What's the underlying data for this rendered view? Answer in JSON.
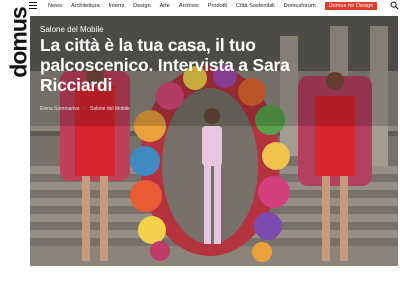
{
  "brand": {
    "logo_text": "domus"
  },
  "nav": {
    "items": [
      "News",
      "Architettura",
      "Interni",
      "Design",
      "Arte",
      "Archivio",
      "Prodotti",
      "Città Sostenibili",
      "Domusforum"
    ],
    "highlight": "Domus for Design"
  },
  "article": {
    "category": "Salone del Mobile",
    "title": "La città è la tua casa, il tuo palcoscenico. Intervista a Sara Ricciardi",
    "author": "Elena Sommariva",
    "separator": "·",
    "section": "Salone del Mobile"
  },
  "colors": {
    "accent": "#e33a2c",
    "text": "#111111",
    "hero_text": "#ffffff"
  },
  "icons": {
    "menu": "hamburger-icon",
    "search": "search-icon"
  }
}
